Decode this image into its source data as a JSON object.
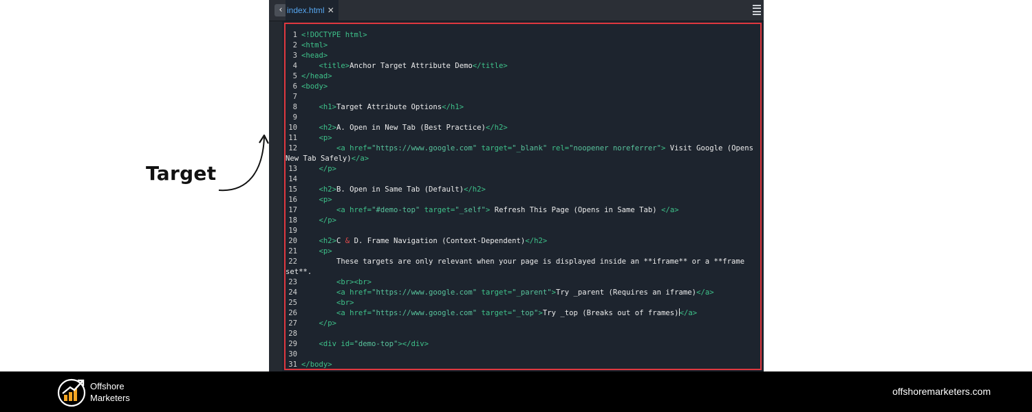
{
  "annotation": {
    "label": "Target"
  },
  "editor": {
    "tab": {
      "filename": "index.html",
      "close_glyph": "✕"
    },
    "back_glyph": "‹"
  },
  "code_lines": [
    {
      "n": "1",
      "segs": [
        {
          "c": "t",
          "v": "<!DOCTYPE html>"
        }
      ]
    },
    {
      "n": "2",
      "segs": [
        {
          "c": "t",
          "v": "<html>"
        }
      ]
    },
    {
      "n": "3",
      "segs": [
        {
          "c": "t",
          "v": "<head>"
        }
      ]
    },
    {
      "n": "4",
      "segs": [
        {
          "c": "x",
          "v": "    "
        },
        {
          "c": "t",
          "v": "<title>"
        },
        {
          "c": "x",
          "v": "Anchor Target Attribute Demo"
        },
        {
          "c": "t",
          "v": "</title>"
        }
      ]
    },
    {
      "n": "5",
      "segs": [
        {
          "c": "t",
          "v": "</head>"
        }
      ]
    },
    {
      "n": "6",
      "segs": [
        {
          "c": "t",
          "v": "<body>"
        }
      ]
    },
    {
      "n": "7",
      "segs": []
    },
    {
      "n": "8",
      "segs": [
        {
          "c": "x",
          "v": "    "
        },
        {
          "c": "t",
          "v": "<h1>"
        },
        {
          "c": "x",
          "v": "Target Attribute Options"
        },
        {
          "c": "t",
          "v": "</h1>"
        }
      ]
    },
    {
      "n": "9",
      "segs": []
    },
    {
      "n": "10",
      "segs": [
        {
          "c": "x",
          "v": "    "
        },
        {
          "c": "t",
          "v": "<h2>"
        },
        {
          "c": "x",
          "v": "A. Open in New Tab (Best Practice)"
        },
        {
          "c": "t",
          "v": "</h2>"
        }
      ]
    },
    {
      "n": "11",
      "segs": [
        {
          "c": "x",
          "v": "    "
        },
        {
          "c": "t",
          "v": "<p>"
        }
      ]
    },
    {
      "n": "12",
      "segs": [
        {
          "c": "x",
          "v": "        "
        },
        {
          "c": "t",
          "v": "<a "
        },
        {
          "c": "a",
          "v": "href="
        },
        {
          "c": "s",
          "v": "\"https://www.google.com\""
        },
        {
          "c": "a",
          "v": " target="
        },
        {
          "c": "s",
          "v": "\"_blank\""
        },
        {
          "c": "a",
          "v": " rel="
        },
        {
          "c": "s",
          "v": "\"noopener noreferrer\""
        },
        {
          "c": "t",
          "v": ">"
        },
        {
          "c": "x",
          "v": " Visit Google (Opens"
        }
      ],
      "wrap": [
        {
          "c": "x",
          "v": "New Tab Safely)"
        },
        {
          "c": "t",
          "v": "</a>"
        }
      ]
    },
    {
      "n": "13",
      "segs": [
        {
          "c": "x",
          "v": "    "
        },
        {
          "c": "t",
          "v": "</p>"
        }
      ]
    },
    {
      "n": "14",
      "segs": []
    },
    {
      "n": "15",
      "segs": [
        {
          "c": "x",
          "v": "    "
        },
        {
          "c": "t",
          "v": "<h2>"
        },
        {
          "c": "x",
          "v": "B. Open in Same Tab (Default)"
        },
        {
          "c": "t",
          "v": "</h2>"
        }
      ]
    },
    {
      "n": "16",
      "segs": [
        {
          "c": "x",
          "v": "    "
        },
        {
          "c": "t",
          "v": "<p>"
        }
      ]
    },
    {
      "n": "17",
      "segs": [
        {
          "c": "x",
          "v": "        "
        },
        {
          "c": "t",
          "v": "<a "
        },
        {
          "c": "a",
          "v": "href="
        },
        {
          "c": "s",
          "v": "\"#demo-top\""
        },
        {
          "c": "a",
          "v": " target="
        },
        {
          "c": "s",
          "v": "\"_self\""
        },
        {
          "c": "t",
          "v": ">"
        },
        {
          "c": "x",
          "v": " Refresh This Page (Opens in Same Tab) "
        },
        {
          "c": "t",
          "v": "</a>"
        }
      ]
    },
    {
      "n": "18",
      "segs": [
        {
          "c": "x",
          "v": "    "
        },
        {
          "c": "t",
          "v": "</p>"
        }
      ]
    },
    {
      "n": "19",
      "segs": []
    },
    {
      "n": "20",
      "segs": [
        {
          "c": "x",
          "v": "    "
        },
        {
          "c": "t",
          "v": "<h2>"
        },
        {
          "c": "x",
          "v": "C "
        },
        {
          "c": "amp",
          "v": "&"
        },
        {
          "c": "x",
          "v": " D. Frame Navigation (Context-Dependent)"
        },
        {
          "c": "t",
          "v": "</h2>"
        }
      ]
    },
    {
      "n": "21",
      "segs": [
        {
          "c": "x",
          "v": "    "
        },
        {
          "c": "t",
          "v": "<p>"
        }
      ]
    },
    {
      "n": "22",
      "segs": [
        {
          "c": "x",
          "v": "        These targets are only relevant when your page is displayed inside an **iframe** or a **frame"
        }
      ],
      "wrap": [
        {
          "c": "x",
          "v": "set**."
        }
      ]
    },
    {
      "n": "23",
      "segs": [
        {
          "c": "x",
          "v": "        "
        },
        {
          "c": "t",
          "v": "<br><br>"
        }
      ]
    },
    {
      "n": "24",
      "segs": [
        {
          "c": "x",
          "v": "        "
        },
        {
          "c": "t",
          "v": "<a "
        },
        {
          "c": "a",
          "v": "href="
        },
        {
          "c": "s",
          "v": "\"https://www.google.com\""
        },
        {
          "c": "a",
          "v": " target="
        },
        {
          "c": "s",
          "v": "\"_parent\""
        },
        {
          "c": "t",
          "v": ">"
        },
        {
          "c": "x",
          "v": "Try _parent (Requires an iframe)"
        },
        {
          "c": "t",
          "v": "</a>"
        }
      ]
    },
    {
      "n": "25",
      "segs": [
        {
          "c": "x",
          "v": "        "
        },
        {
          "c": "t",
          "v": "<br>"
        }
      ]
    },
    {
      "n": "26",
      "segs": [
        {
          "c": "x",
          "v": "        "
        },
        {
          "c": "t",
          "v": "<a "
        },
        {
          "c": "a",
          "v": "href="
        },
        {
          "c": "s",
          "v": "\"https://www.google.com\""
        },
        {
          "c": "a",
          "v": " target="
        },
        {
          "c": "s",
          "v": "\"_top\""
        },
        {
          "c": "t",
          "v": ">"
        },
        {
          "c": "x",
          "v": "Try _top (Breaks out of frames)"
        },
        {
          "c": "cur",
          "v": ""
        },
        {
          "c": "t",
          "v": "</a>"
        }
      ]
    },
    {
      "n": "27",
      "segs": [
        {
          "c": "x",
          "v": "    "
        },
        {
          "c": "t",
          "v": "</p>"
        }
      ]
    },
    {
      "n": "28",
      "segs": []
    },
    {
      "n": "29",
      "segs": [
        {
          "c": "x",
          "v": "    "
        },
        {
          "c": "t",
          "v": "<div "
        },
        {
          "c": "a",
          "v": "id="
        },
        {
          "c": "s",
          "v": "\"demo-top\""
        },
        {
          "c": "t",
          "v": "></div>"
        }
      ]
    },
    {
      "n": "30",
      "segs": []
    },
    {
      "n": "31",
      "segs": [
        {
          "c": "t",
          "v": "</body>"
        }
      ]
    }
  ],
  "footer": {
    "brand_line1": "Offshore",
    "brand_line2": "Marketers",
    "website": "offshoremarketers.com"
  },
  "colors": {
    "editor_bg": "#1d242e",
    "tag": "#3ec28a",
    "highlight_border": "#e0383f",
    "tab_text": "#56a6f0",
    "footer_bg": "#000000",
    "logo_accent": "#f5a623"
  }
}
